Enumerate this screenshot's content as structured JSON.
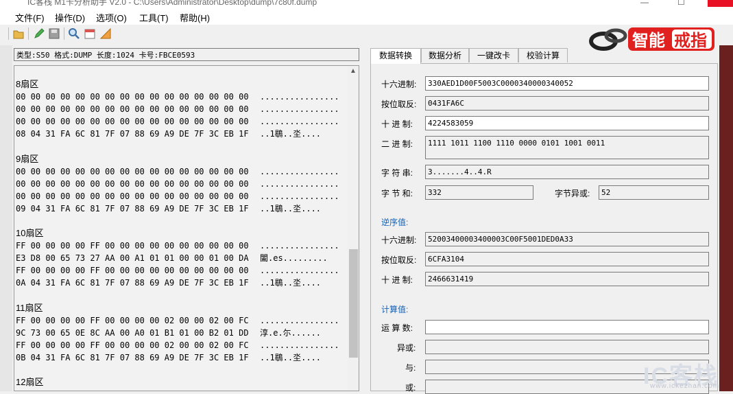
{
  "window": {
    "title": "IC客栈 M1卡分析助手 V2.0 - C:\\Users\\Administrator\\Desktop\\dump\\7c80f.dump",
    "minimize": "—",
    "maximize": "☐",
    "close": "✕"
  },
  "menu": {
    "file": "文件(F)",
    "operate": "操作(D)",
    "options": "选项(O)",
    "tools": "工具(T)",
    "help": "帮助(H)"
  },
  "brand": {
    "smart": "智能",
    "ring": "戒指"
  },
  "info_bar": "类型:S50 格式:DUMP 长度:1024 卡号:FBCE0593",
  "sectors": [
    {
      "title": "8扇区",
      "rows": [
        {
          "hex": "00 00 00 00 00 00 00 00 00 00 00 00 00 00 00 00",
          "ascii": "................"
        },
        {
          "hex": "00 00 00 00 00 00 00 00 00 00 00 00 00 00 00 00",
          "ascii": "................"
        },
        {
          "hex": "00 00 00 00 00 00 00 00 00 00 00 00 00 00 00 00",
          "ascii": "................"
        },
        {
          "hex": "08 04 31 FA 6C 81 7F 07 88 69 A9 DE 7F 3C EB 1F",
          "ascii": "..1鶡..坔...."
        }
      ]
    },
    {
      "title": "9扇区",
      "rows": [
        {
          "hex": "00 00 00 00 00 00 00 00 00 00 00 00 00 00 00 00",
          "ascii": "................"
        },
        {
          "hex": "00 00 00 00 00 00 00 00 00 00 00 00 00 00 00 00",
          "ascii": "................"
        },
        {
          "hex": "00 00 00 00 00 00 00 00 00 00 00 00 00 00 00 00",
          "ascii": "................"
        },
        {
          "hex": "09 04 31 FA 6C 81 7F 07 88 69 A9 DE 7F 3C EB 1F",
          "ascii": "..1鶡..坔...."
        }
      ]
    },
    {
      "title": "10扇区",
      "rows": [
        {
          "hex": "FF 00 00 00 00 FF 00 00 00 00 00 00 00 00 00 00",
          "ascii": "................"
        },
        {
          "hex": "E3 D8 00 65 73 27 AA 00 A1 01 01 00 00 01 00 DA",
          "ascii": "闔.es........."
        },
        {
          "hex": "FF 00 00 00 00 FF 00 00 00 00 00 00 00 00 00 00",
          "ascii": "................"
        },
        {
          "hex": "0A 04 31 FA 6C 81 7F 07 88 69 A9 DE 7F 3C EB 1F",
          "ascii": "..1鶡..坔...."
        }
      ]
    },
    {
      "title": "11扇区",
      "rows": [
        {
          "hex": "FF 00 00 00 00 FF 00 00 00 00 02 00 00 02 00 FC",
          "ascii": "................"
        },
        {
          "hex": "9C 73 00 65 0E 8C AA 00 A0 01 B1 01 00 B2 01 DD",
          "ascii": "淳.e.尓......"
        },
        {
          "hex": "FF 00 00 00 00 FF 00 00 00 00 02 00 00 02 00 FC",
          "ascii": "................"
        },
        {
          "hex": "0B 04 31 FA 6C 81 7F 07 88 69 A9 DE 7F 3C EB 1F",
          "ascii": "..1鶡..坔...."
        }
      ]
    },
    {
      "title": "12扇区",
      "rows": []
    }
  ],
  "tabs": [
    {
      "label": "数据转换",
      "active": true
    },
    {
      "label": "数据分析",
      "active": false
    },
    {
      "label": "一键改卡",
      "active": false
    },
    {
      "label": "校验计算",
      "active": false
    }
  ],
  "conversion": {
    "hex_label": "十六进制:",
    "hex_value": "330AED1D00F5003C0000340000340052",
    "invert_label": "按位取反:",
    "invert_value": "0431FA6C",
    "dec_label": "十 进 制:",
    "dec_value": "4224583059",
    "bin_label": "二 进 制:",
    "bin_value": "1111 1011 1100 1110 0000 0101 1001 0011",
    "str_label": "字 符 串:",
    "str_value": "3.......4..4.R",
    "sum_label": "字 节 和:",
    "sum_value": "332",
    "xor_label": "字节异或:",
    "xor_value": "52"
  },
  "reverse": {
    "title": "逆序值:",
    "hex_label": "十六进制:",
    "hex_value": "52003400003400003C00F5001DED0A33",
    "invert_label": "按位取反:",
    "invert_value": "6CFA3104",
    "dec_label": "十 进 制:",
    "dec_value": "2466631419"
  },
  "calc": {
    "title": "计算值:",
    "operand_label": "运 算 数:",
    "operand_value": "",
    "xor_label": "异或:",
    "and_label": "与:",
    "or_label": "或:"
  },
  "watermark": {
    "main": "IC客栈",
    "url": "www.ickezhan.com"
  }
}
